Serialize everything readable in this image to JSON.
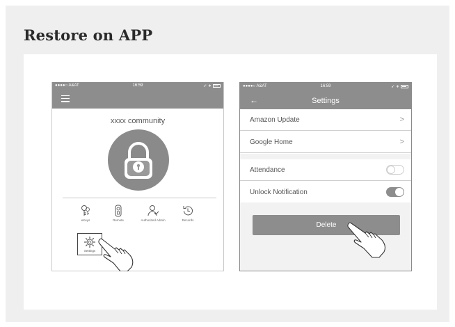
{
  "title": "Restore on APP",
  "statusbar": {
    "carrier": "●●●●○ A&AT",
    "time": "16:59"
  },
  "phone1": {
    "community": "xxxx community",
    "functions": [
      {
        "label": "eKeys",
        "icon": "key-icon"
      },
      {
        "label": "Remote",
        "icon": "remote-icon"
      },
      {
        "label": "Authorized Admin",
        "icon": "admin-icon"
      },
      {
        "label": "Records",
        "icon": "records-icon"
      }
    ],
    "settings_label": "Settings"
  },
  "phone2": {
    "nav_title": "Settings",
    "rows": {
      "amazon": "Amazon Update",
      "google": "Google  Home",
      "attendance": "Attendance",
      "unlock": "Unlock Notification"
    },
    "attendance_on": false,
    "unlock_notification_on": true,
    "delete_label": "Delete"
  }
}
